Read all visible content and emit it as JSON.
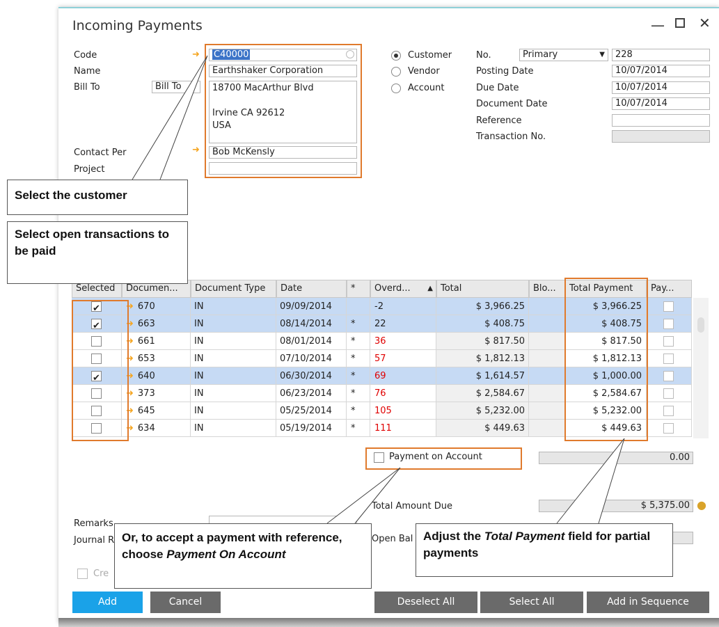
{
  "window": {
    "title": "Incoming Payments"
  },
  "header": {
    "code_label": "Code",
    "code_value": "C40000",
    "name_label": "Name",
    "name_value": "Earthshaker Corporation",
    "bill_to_label": "Bill To",
    "bill_to_select": "Bill To",
    "address_line1": "18700 MacArthur Blvd",
    "address_line2": "Irvine CA  92612",
    "address_line3": "USA",
    "contact_label": "Contact Per",
    "contact_value": "Bob McKensly",
    "project_label": "Project",
    "radio_customer": "Customer",
    "radio_vendor": "Vendor",
    "radio_account": "Account",
    "no_label": "No.",
    "no_series": "Primary",
    "no_value": "228",
    "posting_date_label": "Posting Date",
    "posting_date": "10/07/2014",
    "due_date_label": "Due Date",
    "due_date": "10/07/2014",
    "document_date_label": "Document Date",
    "document_date": "10/07/2014",
    "reference_label": "Reference",
    "transaction_no_label": "Transaction No."
  },
  "table": {
    "headers": [
      "Selected",
      "Documen...",
      "Document Type",
      "Date",
      "*",
      "Overd...",
      "Total",
      "Blo...",
      "Total Payment",
      "Pay..."
    ],
    "rows": [
      {
        "selected": true,
        "doc": "670",
        "type": "IN",
        "date": "09/09/2014",
        "star": "",
        "overdue": "-2",
        "total": "$ 3,966.25",
        "payment": "$ 3,966.25",
        "highlight": true
      },
      {
        "selected": true,
        "doc": "663",
        "type": "IN",
        "date": "08/14/2014",
        "star": "*",
        "overdue": "22",
        "total": "$ 408.75",
        "payment": "$ 408.75",
        "highlight": true
      },
      {
        "selected": false,
        "doc": "661",
        "type": "IN",
        "date": "08/01/2014",
        "star": "*",
        "overdue": "36",
        "total": "$ 817.50",
        "payment": "$ 817.50",
        "highlight": false
      },
      {
        "selected": false,
        "doc": "653",
        "type": "IN",
        "date": "07/10/2014",
        "star": "*",
        "overdue": "57",
        "total": "$ 1,812.13",
        "payment": "$ 1,812.13",
        "highlight": false
      },
      {
        "selected": true,
        "doc": "640",
        "type": "IN",
        "date": "06/30/2014",
        "star": "*",
        "overdue": "69",
        "total": "$ 1,614.57",
        "payment": "$ 1,000.00",
        "highlight": true
      },
      {
        "selected": false,
        "doc": "373",
        "type": "IN",
        "date": "06/23/2014",
        "star": "*",
        "overdue": "76",
        "total": "$ 2,584.67",
        "payment": "$ 2,584.67",
        "highlight": false
      },
      {
        "selected": false,
        "doc": "645",
        "type": "IN",
        "date": "05/25/2014",
        "star": "*",
        "overdue": "105",
        "total": "$ 5,232.00",
        "payment": "$ 5,232.00",
        "highlight": false
      },
      {
        "selected": false,
        "doc": "634",
        "type": "IN",
        "date": "05/19/2014",
        "star": "*",
        "overdue": "111",
        "total": "$ 449.63",
        "payment": "$ 449.63",
        "highlight": false
      }
    ]
  },
  "footer": {
    "payment_on_account_label": "Payment on Account",
    "payment_on_account_value": "0.00",
    "total_amount_due_label": "Total Amount Due",
    "total_amount_due_value": "$ 5,375.00",
    "remarks_label": "Remarks",
    "journal_label": "Journal R",
    "open_bal_label": "Open Bal",
    "create_label": "Cre"
  },
  "buttons": {
    "add": "Add",
    "cancel": "Cancel",
    "deselect_all": "Deselect All",
    "select_all": "Select All",
    "add_in_sequence": "Add in Sequence"
  },
  "callouts": {
    "select_customer": "Select the customer",
    "select_open": "Select open transactions to be paid",
    "payment_on_account_part1": "Or, to accept a payment with reference, choose ",
    "payment_on_account_part2": "Payment On Account",
    "adjust_part1": "Adjust the ",
    "adjust_part2": "Total Payment",
    "adjust_part3": " field for partial payments"
  },
  "colors": {
    "highlight_row": "#c6daf4",
    "callout_border": "#e07a2c",
    "add_button": "#1aa2e8",
    "overdue_red": "#e00000"
  }
}
